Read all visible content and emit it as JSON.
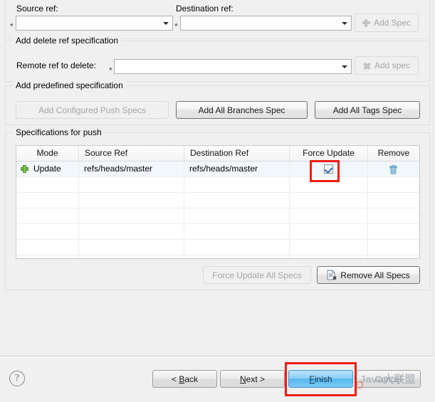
{
  "window": {
    "kind": "eclipse-push-wizard-page"
  },
  "add_ref_spec": {
    "source_label": "Source ref:",
    "source_value": "",
    "source_required_marker": "*",
    "destination_label": "Destination ref:",
    "destination_value": "",
    "destination_required_marker": "*",
    "add_spec_button": "Add Spec",
    "add_spec_icon": "plus-icon",
    "add_spec_enabled": false
  },
  "delete_ref_spec": {
    "group_title": "Add delete ref specification",
    "remote_ref_label": "Remote ref to delete:",
    "remote_ref_value": "",
    "remote_ref_required_marker": "*",
    "add_spec_button": "Add spec",
    "add_spec_icon": "x-icon",
    "add_spec_enabled": false
  },
  "predefined_spec": {
    "group_title": "Add predefined specification",
    "buttons": [
      {
        "label": "Add Configured Push Specs",
        "enabled": false
      },
      {
        "label": "Add All Branches Spec",
        "enabled": true
      },
      {
        "label": "Add All Tags Spec",
        "enabled": true
      }
    ]
  },
  "specs_for_push": {
    "group_title": "Specifications for push",
    "columns": [
      "Mode",
      "Source Ref",
      "Destination Ref",
      "Force Update",
      "Remove"
    ],
    "rows": [
      {
        "mode_icon": "green-plus-icon",
        "mode": "Update",
        "source_ref": "refs/heads/master",
        "destination_ref": "refs/heads/master",
        "force_update": true,
        "remove_icon": "trash-icon",
        "selected": true
      }
    ],
    "empty_row_count": 6,
    "footer_buttons": [
      {
        "label": "Force Update All Specs",
        "enabled": false,
        "icon": null
      },
      {
        "label": "Remove All Specs",
        "enabled": true,
        "icon": "document-delete-icon"
      }
    ]
  },
  "wizard_footer": {
    "help_icon": "question-mark-icon",
    "back_button": {
      "prefix": "< ",
      "mnemonic": "B",
      "rest": "ack"
    },
    "next_button": {
      "mnemonic": "N",
      "rest": "ext",
      "suffix": " >"
    },
    "finish_button": {
      "mnemonic": "F",
      "rest": "inish"
    },
    "cancel_button": {
      "label": "Cancel"
    }
  },
  "annotations": {
    "highlight_color": "#ee1d14",
    "highlights": [
      "force-update-checkbox",
      "finish-button"
    ]
  },
  "watermark": {
    "text": "Java大联盟"
  }
}
